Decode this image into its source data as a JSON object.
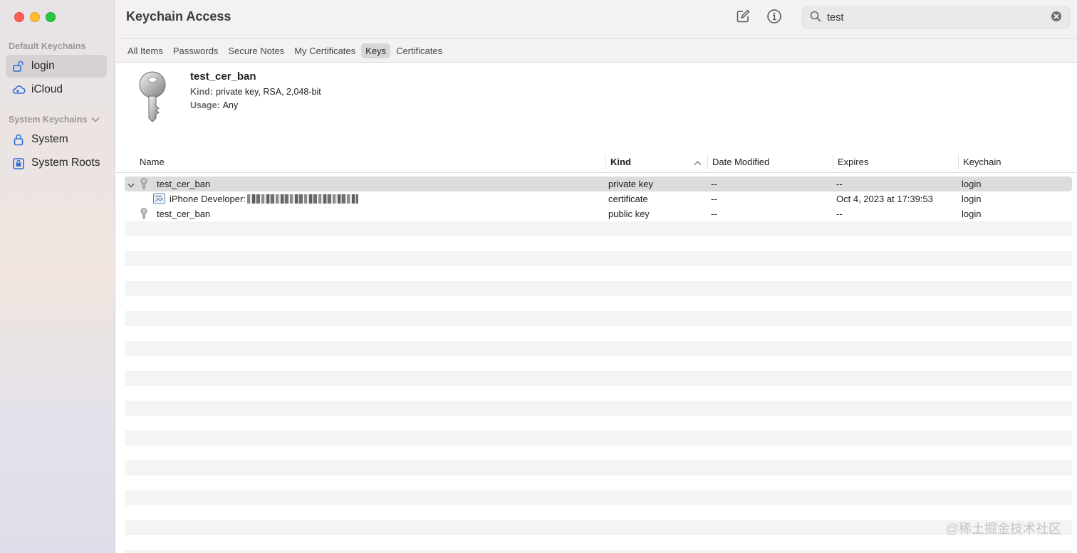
{
  "window": {
    "title": "Keychain Access"
  },
  "sidebar": {
    "default_header": "Default Keychains",
    "system_header": "System Keychains",
    "items": [
      {
        "label": "login",
        "icon": "unlocked-padlock-icon",
        "selected": true
      },
      {
        "label": "iCloud",
        "icon": "icloud-icon",
        "selected": false
      }
    ],
    "system_items": [
      {
        "label": "System",
        "icon": "padlock-icon"
      },
      {
        "label": "System Roots",
        "icon": "locked-cabinet-icon"
      }
    ]
  },
  "toolbar": {
    "compose_icon": "compose-icon",
    "info_icon": "info-icon",
    "search": {
      "value": "test",
      "placeholder": "Search"
    }
  },
  "tabs": [
    "All Items",
    "Passwords",
    "Secure Notes",
    "My Certificates",
    "Keys",
    "Certificates"
  ],
  "active_tab": "Keys",
  "info": {
    "name": "test_cer_ban",
    "kind_label": "Kind:",
    "kind_value": "private key, RSA, 2,048-bit",
    "usage_label": "Usage:",
    "usage_value": "Any"
  },
  "table": {
    "columns": [
      "Name",
      "Kind",
      "Date Modified",
      "Expires",
      "Keychain"
    ],
    "sorted_column": "Kind",
    "rows": [
      {
        "name": "test_cer_ban",
        "kind": "private key",
        "modified": "--",
        "expires": "--",
        "keychain": "login"
      },
      {
        "name": "iPhone Developer:",
        "kind": "certificate",
        "modified": "--",
        "expires": "Oct 4, 2023 at 17:39:53",
        "keychain": "login"
      },
      {
        "name": "test_cer_ban",
        "kind": "public key",
        "modified": "--",
        "expires": "--",
        "keychain": "login"
      }
    ]
  },
  "watermark": "@稀土掘金技术社区"
}
